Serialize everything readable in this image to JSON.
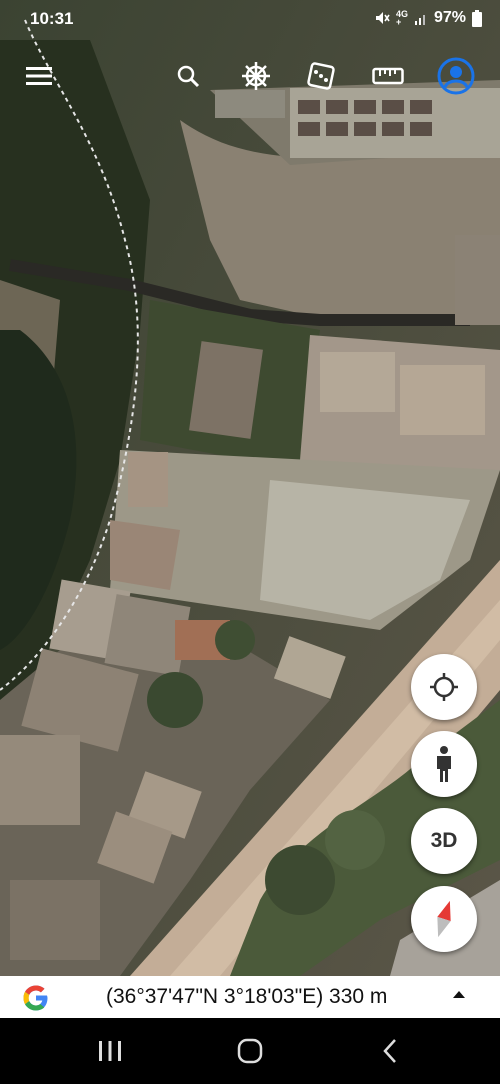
{
  "status_bar": {
    "time": "10:31",
    "network_top": "4G",
    "network_bottom": "+",
    "battery": "97%",
    "icons": [
      "mute-icon",
      "signal-icon",
      "battery-icon"
    ]
  },
  "toolbar": {
    "icons": [
      "menu-icon",
      "search-icon",
      "voyager-wheel-icon",
      "feeling-lucky-dice-icon",
      "measure-ruler-icon",
      "account-icon"
    ],
    "accent_color": "#1a73e8"
  },
  "map_controls": {
    "three_d_label": "3D",
    "icons": [
      "my-location-icon",
      "pegman-icon",
      "compass-icon"
    ]
  },
  "info_bar": {
    "coordinates": "(36°37'47\"N 3°18'03\"E) 330 m",
    "logo": "google-g-logo"
  },
  "nav_bar": {
    "icons": [
      "recent-apps-icon",
      "home-icon",
      "back-icon"
    ]
  }
}
